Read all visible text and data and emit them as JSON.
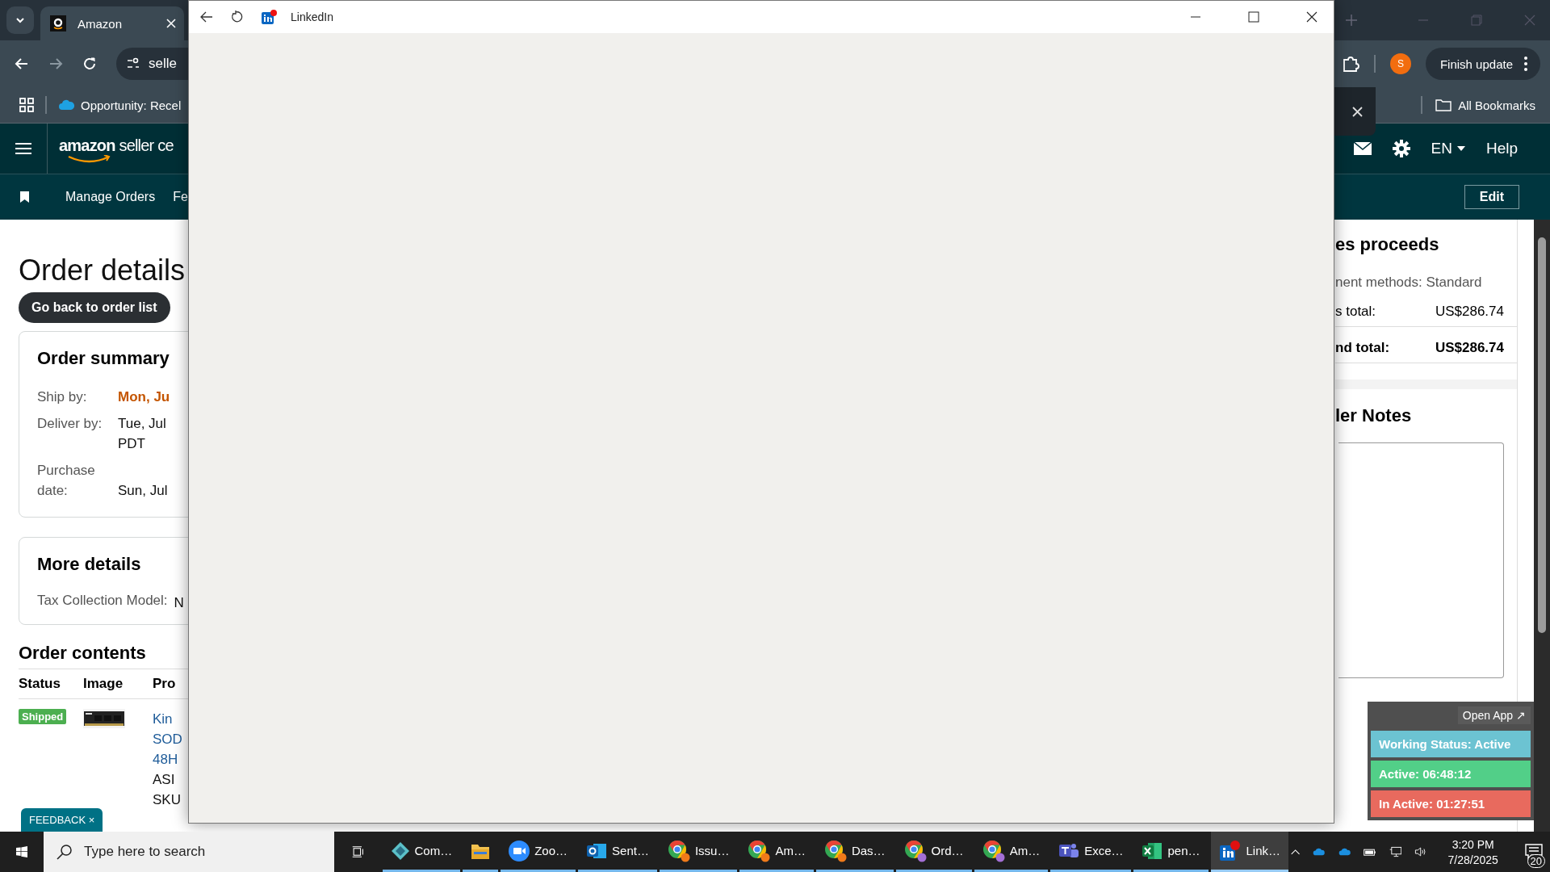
{
  "browser": {
    "tab": {
      "title": "Amazon"
    },
    "address": "selle",
    "profile_initial": "S",
    "update_button": "Finish update",
    "bookmarks": [
      {
        "label": "Opportunity: Recel"
      }
    ],
    "all_bookmarks": "All Bookmarks"
  },
  "seller_header": {
    "logo": "**amazon** seller ce",
    "language": "EN",
    "help": "Help"
  },
  "nav": {
    "items": [
      "Manage Orders",
      "Fe"
    ],
    "edit_button": "Edit"
  },
  "order": {
    "title": "Order details",
    "back_button": "Go back to order list",
    "summary": {
      "title": "Order summary",
      "rows": [
        {
          "label": "Ship by:",
          "value": [
            "Mon, Ju"
          ],
          "emphasis": true
        },
        {
          "label": "Deliver by:",
          "value": [
            "Tue, Jul",
            "PDT"
          ],
          "emphasis": false
        },
        {
          "label": "Purchase date:",
          "value": [
            "Sun, Jul"
          ],
          "emphasis": false
        }
      ]
    },
    "more": {
      "title": "More details",
      "rows": [
        {
          "label": "Tax Collection Model:",
          "value": "N"
        }
      ]
    },
    "contents": {
      "title": "Order contents",
      "columns": [
        "Status",
        "Image",
        "Pro"
      ],
      "rows": [
        {
          "status": "Shipped",
          "image": {
            "kind": "picture"
          },
          "product_lines": [
            "Kin",
            "SOD",
            "48H"
          ],
          "detail_lines": [
            "ASI",
            "SKU"
          ]
        }
      ]
    }
  },
  "feedback_tab": {
    "label": "FEEDBACK",
    "close": "×"
  },
  "proceeds": {
    "title": "es proceeds",
    "payment": "nent methods: Standard",
    "rows": [
      {
        "label": "s total:",
        "value": "US$286.74",
        "bold": false
      },
      {
        "label": "nd total:",
        "value": "US$286.74",
        "bold": true
      }
    ]
  },
  "notes": {
    "title": "ler Notes"
  },
  "tracker": {
    "open_app": "Open App ↗",
    "statuses": [
      {
        "text": "Working Status: Active",
        "color": "#6cc3d2"
      },
      {
        "text": "Active: 06:48:12",
        "color": "#52cf88"
      },
      {
        "text": "In Active: 01:27:51",
        "color": "#e86a5e"
      }
    ]
  },
  "linkedin_window": {
    "title": "LinkedIn"
  },
  "taskbar": {
    "search_placeholder": "Type here to search",
    "apps": [
      {
        "kind": "compass",
        "label": "Com…",
        "selected": false
      },
      {
        "kind": "folder",
        "selected": false
      },
      {
        "kind": "zoom",
        "label": "Zoo…",
        "selected": false
      },
      {
        "kind": "outlook",
        "label": "Sent…",
        "selected": false
      },
      {
        "kind": "chrome",
        "label": "Issu…",
        "color": "#f07a1a",
        "selected": false
      },
      {
        "kind": "chrome",
        "label": "Am…",
        "color": "#f07a1a",
        "selected": false
      },
      {
        "kind": "chrome",
        "label": "Das…",
        "color": "#f07a1a",
        "selected": false
      },
      {
        "kind": "chrome",
        "label": "Ord…",
        "color": "#a46fd6",
        "selected": false
      },
      {
        "kind": "chrome",
        "label": "Am…",
        "color": "#a46fd6",
        "selected": false
      },
      {
        "kind": "teams",
        "label": "Exce…",
        "selected": false
      },
      {
        "kind": "excel",
        "label": "pen…",
        "selected": false
      },
      {
        "kind": "linkedin",
        "label": "Link…",
        "selected": true
      }
    ],
    "time": "3:20 PM",
    "date": "7/28/2025",
    "notifications": "20"
  }
}
